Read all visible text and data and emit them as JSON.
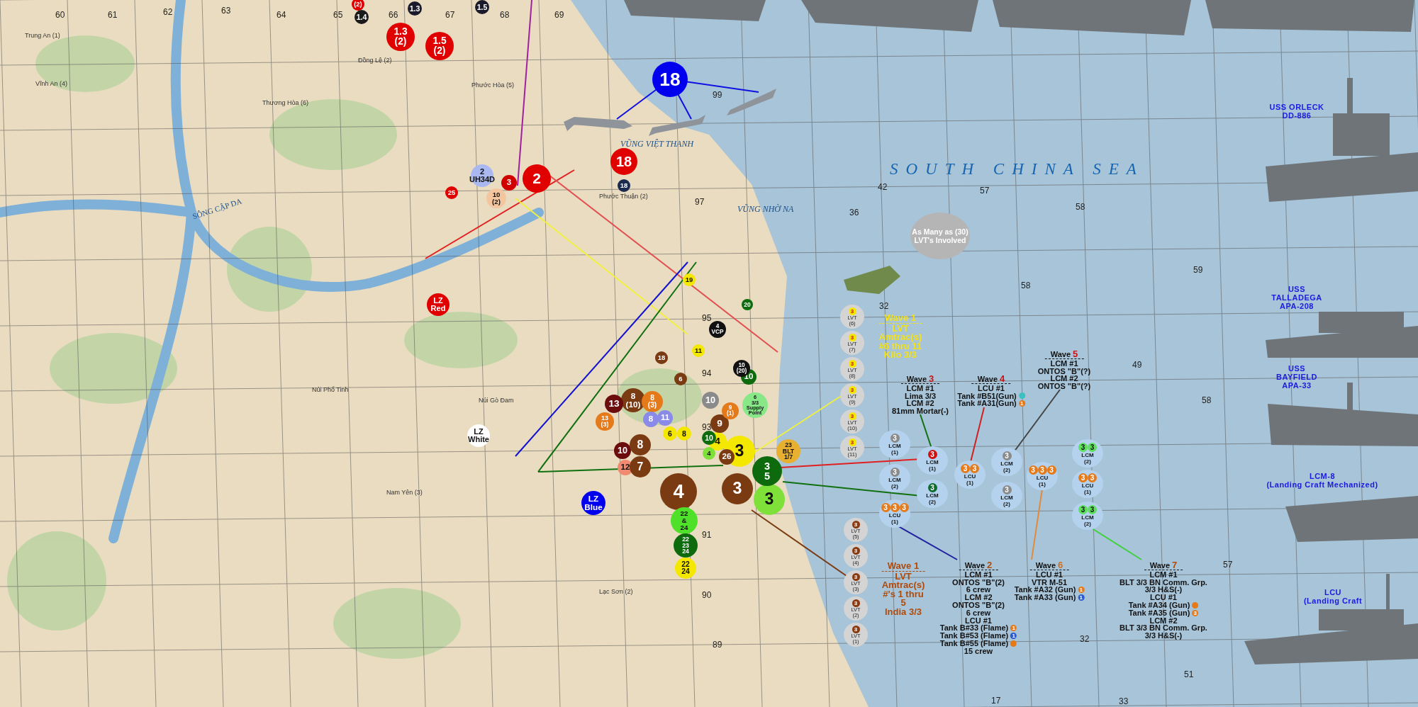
{
  "sea_label": "SOUTH CHINA SEA",
  "callout": "As Many as (30) LVT's Involved",
  "grid_numbers": [
    "60",
    "61",
    "62",
    "63",
    "64",
    "65",
    "66",
    "67",
    "68",
    "69",
    "99",
    "97",
    "95",
    "94",
    "93",
    "91",
    "90",
    "89",
    "42",
    "57",
    "58",
    "36",
    "32",
    "58",
    "59",
    "49",
    "58",
    "57",
    "51",
    "32",
    "17",
    "33"
  ],
  "place_names": [
    {
      "kind": "village",
      "text": "Trung An (1)"
    },
    {
      "kind": "village",
      "text": "Vĩnh An (4)"
    },
    {
      "kind": "village",
      "text": "Đồng Lệ (2)"
    },
    {
      "kind": "village",
      "text": "Phước Hòa (5)"
    },
    {
      "kind": "village",
      "text": "Thương Hòa (6)"
    },
    {
      "kind": "village",
      "text": "Phước Thuận (2)"
    },
    {
      "kind": "village",
      "text": "Núi Phổ Tinh"
    },
    {
      "kind": "village",
      "text": "Núi Gò Đam"
    },
    {
      "kind": "village",
      "text": "Nam Yên (3)"
    },
    {
      "kind": "village",
      "text": "Lạc Sơn (2)"
    },
    {
      "kind": "bay",
      "text": "VŨNG VIỆT THANH"
    },
    {
      "kind": "bay",
      "text": "VŨNG NHỜ NA"
    },
    {
      "kind": "river",
      "text": "SÔNG CẬP DA"
    }
  ],
  "markers": [
    {
      "lines": [
        "(2)"
      ],
      "color": "#e00000"
    },
    {
      "lines": [
        "1.4"
      ],
      "color": "#1a1a1a"
    },
    {
      "lines": [
        "1.3"
      ],
      "color": "#1a1a2a"
    },
    {
      "lines": [
        "1.5"
      ],
      "color": "#1a1a2a"
    },
    {
      "lines": [
        "1.3",
        "(2)"
      ],
      "color": "#e00000"
    },
    {
      "lines": [
        "1.5",
        "(2)"
      ],
      "color": "#e00000"
    },
    {
      "lines": [
        "18"
      ],
      "color": "#0000ee"
    },
    {
      "lines": [
        "18"
      ],
      "color": "#e00000"
    },
    {
      "lines": [
        "18"
      ],
      "color": "#1c2a50"
    },
    {
      "lines": [
        "2",
        "UH34D"
      ],
      "color": "#a9b8f0"
    },
    {
      "lines": [
        "3"
      ],
      "color": "#d00000"
    },
    {
      "lines": [
        "2"
      ],
      "color": "#e00000"
    },
    {
      "lines": [
        "25"
      ],
      "color": "#e00000"
    },
    {
      "lines": [
        "10",
        "(2)"
      ],
      "color": "#f3c6a0"
    },
    {
      "lines": [
        "LZ",
        "Red"
      ],
      "color": "#e00000"
    },
    {
      "lines": [
        "LZ",
        "White"
      ],
      "color": "#ffffff"
    },
    {
      "lines": [
        "LZ",
        "Blue"
      ],
      "color": "#0000ee"
    },
    {
      "lines": [
        "4"
      ],
      "color": "#7a3a12"
    },
    {
      "lines": [
        "3"
      ],
      "color": "#7a3a12"
    },
    {
      "lines": [
        "3"
      ],
      "color": "#7fe03a"
    },
    {
      "lines": [
        "3",
        "5"
      ],
      "color": "#0d6b0d"
    },
    {
      "lines": [
        "3"
      ],
      "color": "#f5e800"
    },
    {
      "lines": [
        "4"
      ],
      "color": "#f5e800"
    },
    {
      "lines": [
        "26"
      ],
      "color": "#7a3a12"
    },
    {
      "lines": [
        "10"
      ],
      "color": "#0d6b0d"
    },
    {
      "lines": [
        "4"
      ],
      "color": "#7fe03a"
    },
    {
      "lines": [
        "22",
        "&",
        "24"
      ],
      "color": "#4fe02a"
    },
    {
      "lines": [
        "22",
        "23",
        "24"
      ],
      "color": "#0d6b0d"
    },
    {
      "lines": [
        "22",
        "24"
      ],
      "color": "#f5e800"
    },
    {
      "lines": [
        "23",
        "BLT",
        "1/7"
      ],
      "color": "#e7b030"
    },
    {
      "lines": [
        "6",
        "3/3",
        "Supply",
        "Point"
      ],
      "color": "#88e888"
    },
    {
      "lines": [
        "12"
      ],
      "color": "#f08a70"
    },
    {
      "lines": [
        "7"
      ],
      "color": "#7a3a12"
    },
    {
      "lines": [
        "10"
      ],
      "color": "#6b0d0d"
    },
    {
      "lines": [
        "8"
      ],
      "color": "#7a3a12"
    },
    {
      "lines": [
        "8",
        "(10)"
      ],
      "color": "#7a3a12"
    },
    {
      "lines": [
        "8",
        "(3)"
      ],
      "color": "#e57a1a"
    },
    {
      "lines": [
        "8"
      ],
      "color": "#8a8ae8"
    },
    {
      "lines": [
        "11"
      ],
      "color": "#8a8ae8"
    },
    {
      "lines": [
        "6"
      ],
      "color": "#f5e800"
    },
    {
      "lines": [
        "8"
      ],
      "color": "#f5e800"
    },
    {
      "lines": [
        "13"
      ],
      "color": "#6b0d0d"
    },
    {
      "lines": [
        "13",
        "(3)"
      ],
      "color": "#e57a1a"
    },
    {
      "lines": [
        "9"
      ],
      "color": "#7a3a12"
    },
    {
      "lines": [
        "9",
        "(1)"
      ],
      "color": "#e57a1a"
    },
    {
      "lines": [
        "10"
      ],
      "color": "#8a8a8a"
    },
    {
      "lines": [
        "19"
      ],
      "color": "#f5e800"
    },
    {
      "lines": [
        "20"
      ],
      "color": "#0d6b0d"
    },
    {
      "lines": [
        "10"
      ],
      "color": "#0d6b0d"
    },
    {
      "lines": [
        "11"
      ],
      "color": "#f5e800"
    },
    {
      "lines": [
        "6"
      ],
      "color": "#7a3a12"
    },
    {
      "lines": [
        "18"
      ],
      "color": "#7a3a12"
    },
    {
      "lines": [
        "4",
        "VCP"
      ],
      "color": "#111111"
    },
    {
      "lines": [
        "10",
        "(20)"
      ],
      "color": "#111111"
    }
  ],
  "lvt_columns": [
    {
      "color": "#f5e800",
      "items": [
        {
          "badge": "3",
          "label": "LVT",
          "number": "(6)"
        },
        {
          "badge": "3",
          "label": "LVT",
          "number": "(7)"
        },
        {
          "badge": "3",
          "label": "LVT",
          "number": "(8)"
        },
        {
          "badge": "3",
          "label": "LVT",
          "number": "(9)"
        },
        {
          "badge": "3",
          "label": "LVT",
          "number": "(10)"
        },
        {
          "badge": "3",
          "label": "LVT",
          "number": "(11)"
        }
      ]
    },
    {
      "color": "#8a3a10",
      "items": [
        {
          "badge": "3",
          "label": "LVT",
          "number": "(5)"
        },
        {
          "badge": "3",
          "label": "LVT",
          "number": "(4)"
        },
        {
          "badge": "3",
          "label": "LVT",
          "number": "(3)"
        },
        {
          "badge": "3",
          "label": "LVT",
          "number": "(2)"
        },
        {
          "badge": "3",
          "label": "LVT",
          "number": "(1)"
        }
      ]
    }
  ],
  "landing_craft": [
    {
      "label": "LCM",
      "number": "(1)",
      "badges": [
        {
          "text": "3",
          "color": "#8a8a8a"
        }
      ]
    },
    {
      "label": "LCM",
      "number": "(2)",
      "badges": [
        {
          "text": "3",
          "color": "#8a8a8a"
        }
      ]
    },
    {
      "label": "LCU",
      "number": "(1)",
      "badges": [
        {
          "text": "3",
          "color": "#e57a1a"
        },
        {
          "text": "3",
          "color": "#e57a1a"
        },
        {
          "text": "3",
          "color": "#e57a1a"
        }
      ]
    },
    {
      "label": "LCM",
      "number": "(1)",
      "badges": [
        {
          "text": "3",
          "color": "#d01010"
        }
      ]
    },
    {
      "label": "LCM",
      "number": "(2)",
      "badges": [
        {
          "text": "3",
          "color": "#0d6b2d"
        }
      ]
    },
    {
      "label": "LCU",
      "number": "(1)",
      "badges": [
        {
          "text": "3",
          "color": "#e57a1a"
        },
        {
          "text": "3",
          "color": "#e57a1a"
        }
      ]
    },
    {
      "label": "LCM",
      "number": "(2)",
      "badges": [
        {
          "text": "3",
          "color": "#8a8a8a"
        }
      ]
    },
    {
      "label": "LCM",
      "number": "(2)",
      "badges": [
        {
          "text": "3",
          "color": "#8a8a8a"
        }
      ]
    },
    {
      "label": "LCU",
      "number": "(1)",
      "badges": [
        {
          "text": "3",
          "color": "#e57a1a"
        },
        {
          "text": "3",
          "color": "#e57a1a"
        },
        {
          "text": "3",
          "color": "#e57a1a"
        }
      ]
    },
    {
      "label": "LCM",
      "number": "(2)",
      "badges": [
        {
          "text": "3",
          "color": "#5ee05e"
        },
        {
          "text": "3",
          "color": "#5ee05e"
        }
      ]
    },
    {
      "label": "LCU",
      "number": "(1)",
      "badges": [
        {
          "text": "3",
          "color": "#e57a1a"
        },
        {
          "text": "3",
          "color": "#e57a1a"
        }
      ]
    },
    {
      "label": "LCM",
      "number": "(2)",
      "badges": [
        {
          "text": "3",
          "color": "#5ee05e"
        },
        {
          "text": "3",
          "color": "#5ee05e"
        }
      ]
    }
  ],
  "waves": [
    {
      "kind": "lvt",
      "title": "Wave 1",
      "color": "#f2e21a",
      "lines": [
        {
          "text": "LVT"
        },
        {
          "text": "Amtrac(s)"
        },
        {
          "text": "#6 thru 11"
        },
        {
          "text": "Kilo 3/3"
        }
      ]
    },
    {
      "kind": "boat",
      "title": "Wave",
      "number": "3",
      "color": "#d01010",
      "lines": [
        {
          "text": "LCM #1"
        },
        {
          "text": "Lima 3/3"
        },
        {
          "text": "LCM #2"
        },
        {
          "text": "81mm Mortar(-)"
        }
      ]
    },
    {
      "kind": "boat",
      "title": "Wave",
      "number": "4",
      "color": "#d01010",
      "lines": [
        {
          "text": "LCU #1"
        },
        {
          "text": "Tank #B51(Gun)",
          "badge": {
            "color": "#3fc0c0"
          }
        },
        {
          "text": "Tank #A31(Gun)",
          "badge": {
            "color": "#e57a1a",
            "text": "1"
          }
        }
      ]
    },
    {
      "kind": "boat",
      "title": "Wave",
      "number": "5",
      "color": "#d01010",
      "lines": [
        {
          "text": "LCM #1"
        },
        {
          "text": "ONTOS \"B\"(?)"
        },
        {
          "text": "LCM #2"
        },
        {
          "text": "ONTOS \"B\"(?)"
        }
      ]
    },
    {
      "kind": "lvt",
      "title": "Wave 1",
      "color": "#b04a0a",
      "lines": [
        {
          "text": "LVT"
        },
        {
          "text": "Amtrac(s)"
        },
        {
          "text": "#'s 1 thru"
        },
        {
          "text": "5"
        },
        {
          "text": "India 3/3"
        }
      ]
    },
    {
      "kind": "boat",
      "title": "Wave",
      "number": "2",
      "color": "#b04a0a",
      "lines": [
        {
          "text": "LCM #1"
        },
        {
          "text": "ONTOS \"B\"(2)"
        },
        {
          "text": "6 crew"
        },
        {
          "text": "LCM #2"
        },
        {
          "text": "ONTOS \"B\"(2)"
        },
        {
          "text": "6 crew"
        },
        {
          "text": "LCU #1"
        },
        {
          "text": "Tank B#33 (Flame)",
          "badge": {
            "color": "#e57a1a",
            "text": "1"
          }
        },
        {
          "text": "Tank B#53 (Flame)",
          "badge": {
            "color": "#2a5ad0",
            "text": "1"
          }
        },
        {
          "text": "Tank B#55 (Flame)",
          "badge": {
            "color": "#e57a1a"
          }
        },
        {
          "text": "15 crew"
        }
      ]
    },
    {
      "kind": "boat",
      "title": "Wave",
      "number": "6",
      "color": "#d07020",
      "lines": [
        {
          "text": "LCU #1"
        },
        {
          "text": "VTR M-51"
        },
        {
          "text": "Tank #A32 (Gun)",
          "badge": {
            "color": "#e57a1a",
            "text": "1"
          }
        },
        {
          "text": "Tank #A33 (Gun)",
          "badge": {
            "color": "#2a5ad0",
            "text": "1"
          }
        }
      ]
    },
    {
      "kind": "boat",
      "title": "Wave",
      "number": "7",
      "color": "#b04a0a",
      "lines": [
        {
          "text": "LCM #1"
        },
        {
          "text": "BLT 3/3 BN Comm. Grp."
        },
        {
          "text": "3/3 H&S(-)"
        },
        {
          "text": "LCU #1"
        },
        {
          "text": "Tank #A34 (Gun)",
          "badge": {
            "color": "#e57a1a"
          }
        },
        {
          "text": "Tank #A35 (Gun)",
          "badge": {
            "color": "#e57a1a",
            "text": "3"
          }
        },
        {
          "text": "LCM #2"
        },
        {
          "text": "BLT 3/3 BN Comm. Grp."
        },
        {
          "text": "3/3 H&S(-)"
        }
      ]
    }
  ],
  "ship_labels": [
    {
      "lines": [
        "USS ORLECK",
        "DD-886"
      ]
    },
    {
      "lines": [
        "USS",
        "TALLADEGA",
        "APA-208"
      ]
    },
    {
      "lines": [
        "USS",
        "BAYFIELD",
        "APA-33"
      ]
    },
    {
      "lines": [
        "LCM-8",
        "(Landing Craft Mechanized)"
      ]
    },
    {
      "lines": [
        "LCU",
        "(Landing Craft"
      ]
    }
  ]
}
